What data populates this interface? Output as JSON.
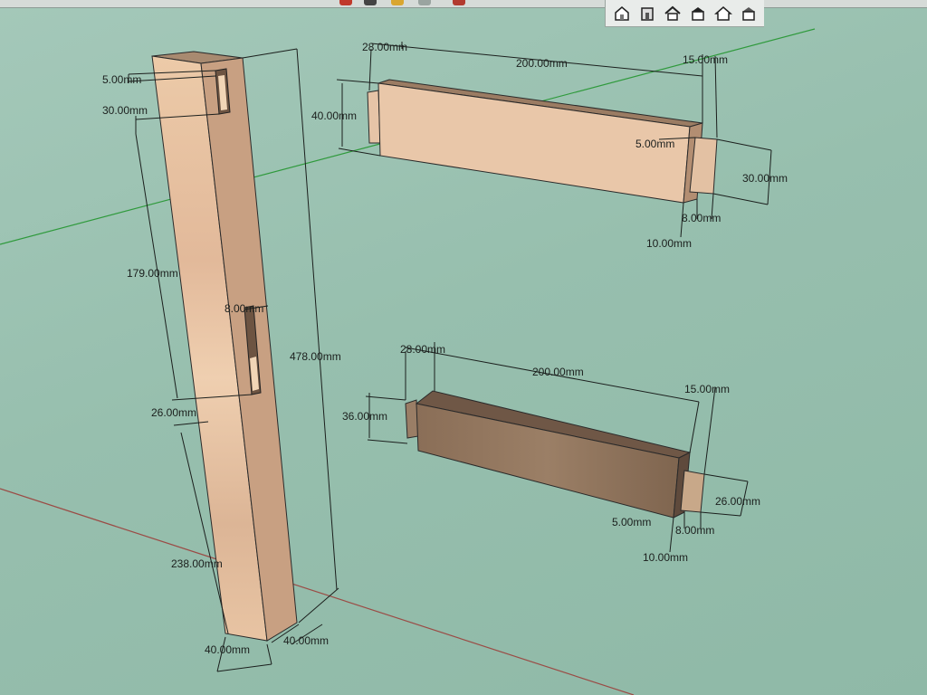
{
  "toolbar": {
    "view_icons": [
      "iso-view-icon",
      "front-house-icon",
      "top-house-icon",
      "front-view-icon",
      "right-view-icon",
      "back-view-icon"
    ]
  },
  "colors": {
    "background": "#9fc4b5",
    "wood_light": "#e7c3a4",
    "wood_side": "#c9a184",
    "wood_dark": "#7d6450",
    "dimension_line": "#1b1f1d",
    "green_axis": "#2f9a3c",
    "red_axis": "#9b4b45"
  },
  "post": {
    "dims": {
      "top_offset": "5.00mm",
      "mortise_top": "30.00mm",
      "mid_gap": "179.00mm",
      "mortise_width": "8.00mm",
      "lower_mortise": "26.00mm",
      "bottom": "238.00mm",
      "height": "478.00mm",
      "width_x": "40.00mm",
      "width_y": "40.00mm"
    }
  },
  "rail_top": {
    "dims": {
      "shoulder": "28.00mm",
      "length": "200.00mm",
      "tenon_length": "15.00mm",
      "height": "40.00mm",
      "tenon_offset": "5.00mm",
      "tenon_height": "30.00mm",
      "tenon_thickness": "8.00mm",
      "depth": "10.00mm"
    }
  },
  "rail_bottom": {
    "dims": {
      "shoulder": "28.00mm",
      "length": "200.00mm",
      "tenon_length": "15.00mm",
      "height": "36.00mm",
      "tenon_height": "26.00mm",
      "tenon_offset": "5.00mm",
      "tenon_thickness": "8.00mm",
      "depth": "10.00mm"
    }
  }
}
